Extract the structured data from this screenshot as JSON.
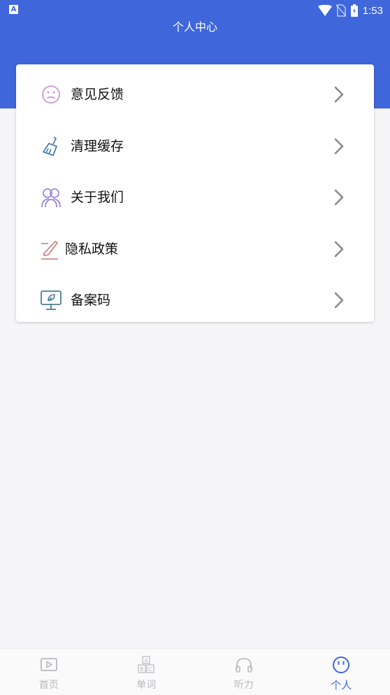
{
  "status_bar": {
    "time": "1:53",
    "badge": "A"
  },
  "header": {
    "title": "个人中心"
  },
  "menu": {
    "items": [
      {
        "label": "意见反馈",
        "icon": "sad-face-icon"
      },
      {
        "label": "清理缓存",
        "icon": "broom-icon"
      },
      {
        "label": "关于我们",
        "icon": "people-icon"
      },
      {
        "label": "隐私政策",
        "icon": "pen-signature-icon"
      },
      {
        "label": "备案码",
        "icon": "monitor-leaf-icon"
      }
    ]
  },
  "bottom_nav": {
    "items": [
      {
        "label": "首页",
        "icon": "video-play-icon",
        "active": false
      },
      {
        "label": "单词",
        "icon": "abc-blocks-icon",
        "active": false
      },
      {
        "label": "听力",
        "icon": "headphones-icon",
        "active": false
      },
      {
        "label": "个人",
        "icon": "smiley-icon",
        "active": true
      }
    ]
  },
  "colors": {
    "primary": "#3f67db",
    "inactive": "#b9b9bd",
    "background": "#f5f5f7"
  }
}
